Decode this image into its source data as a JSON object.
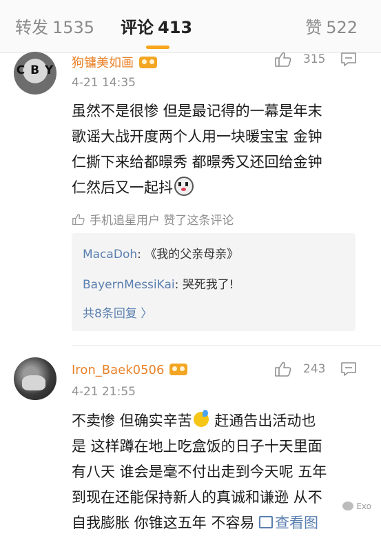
{
  "tabs": {
    "repost": {
      "label": "转发",
      "count": "1535"
    },
    "comment": {
      "label": "评论",
      "count": "413"
    },
    "like": {
      "label": "赞",
      "count": "522"
    }
  },
  "accent_color": "#f7a51c",
  "comments": [
    {
      "username": "狗镛美如画",
      "avatar_text": "C B Y",
      "time": "4-21 14:35",
      "like_count": "315",
      "text": "虽然不是很惨 但是最记得的一幕是年末歌谣大战开度两个人用一块暖宝宝 金钟仁撕下来给都暻秀 都暻秀又还回给金钟仁然后又一起抖",
      "text_lines": [
        "虽然不是很惨 但是最记得的一幕是年末",
        "歌谣大战开度两个人用一块暖宝宝 金钟",
        "仁撕下来给都暻秀 都暻秀又还回给金钟",
        "仁然后又一起抖"
      ],
      "emoji": "scream-emoji",
      "liked_by": "手机追星用户 赞了这条评论",
      "replies": [
        {
          "user": "MacaDoh",
          "sep": ": ",
          "text": "《我的父亲母亲》"
        },
        {
          "user": "BayernMessiKai",
          "sep": ": ",
          "text": "哭死我了!"
        }
      ],
      "more_replies": "共8条回复 〉"
    },
    {
      "username": "Iron_Baek0506",
      "time": "4-21 21:55",
      "like_count": "243",
      "text_lines": [
        "不卖惨 但确实辛苦",
        " 赶通告出活动也",
        "是 这样蹲在地上吃盒饭的日子十天里面",
        "有八天 谁会是毫不付出走到今天呢 五年",
        "到现在还能保持新人的真诚和谦逊 从不",
        "自我膨胀 你锥这五年 不容易 "
      ],
      "emoji": "sweat-emoji",
      "view_pic": "查看图"
    }
  ],
  "watermark": "Exo"
}
